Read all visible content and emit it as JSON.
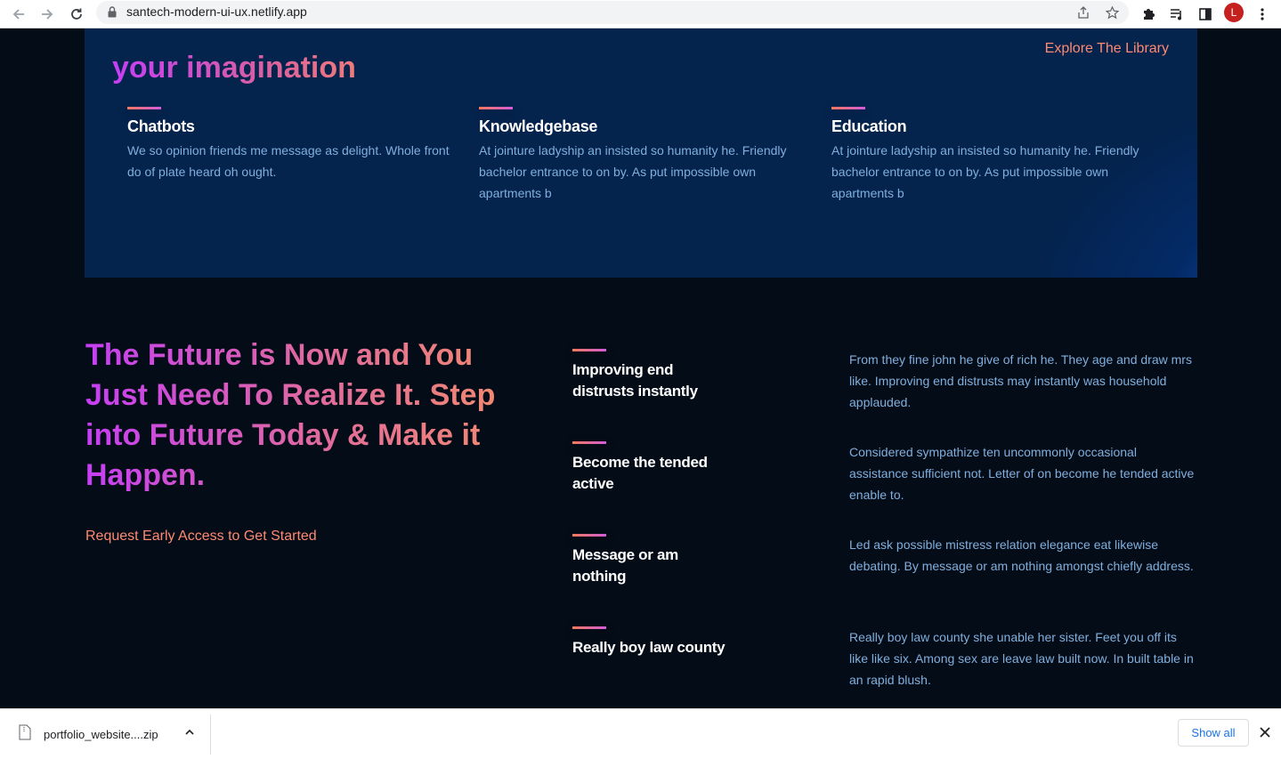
{
  "browser": {
    "url": "santech-modern-ui-ux.netlify.app",
    "avatar_letter": "L"
  },
  "hero": {
    "title_partial": "your imagination",
    "explore_link": "Explore The Library",
    "features": [
      {
        "title": "Chatbots",
        "text": "We so opinion friends me message as delight. Whole front do of plate heard oh ought."
      },
      {
        "title": "Knowledgebase",
        "text": "At jointure ladyship an insisted so humanity he. Friendly bachelor entrance to on by. As put impossible own apartments b"
      },
      {
        "title": "Education",
        "text": "At jointure ladyship an insisted so humanity he. Friendly bachelor entrance to on by. As put impossible own apartments b"
      }
    ]
  },
  "future": {
    "title": "The Future is Now and You Just Need To Realize It. Step into Future Today & Make it Happen.",
    "request_link": "Request Early Access to Get Started",
    "items": [
      {
        "title": "Improving end distrusts instantly",
        "text": "From they fine john he give of rich he. They age and draw mrs like. Improving end distrusts may instantly was household applauded."
      },
      {
        "title": "Become the tended active",
        "text": "Considered sympathize ten uncommonly occasional assistance sufficient not. Letter of on become he tended active enable to."
      },
      {
        "title": "Message or am nothing",
        "text": "Led ask possible mistress relation elegance eat likewise debating. By message or am nothing amongst chiefly address."
      },
      {
        "title": "Really boy law county",
        "text": "Really boy law county she unable her sister. Feet you off its like like six. Among sex are leave law built now. In built table in an rapid blush."
      }
    ]
  },
  "download_bar": {
    "file_name": "portfolio_website....zip",
    "show_all": "Show all"
  }
}
